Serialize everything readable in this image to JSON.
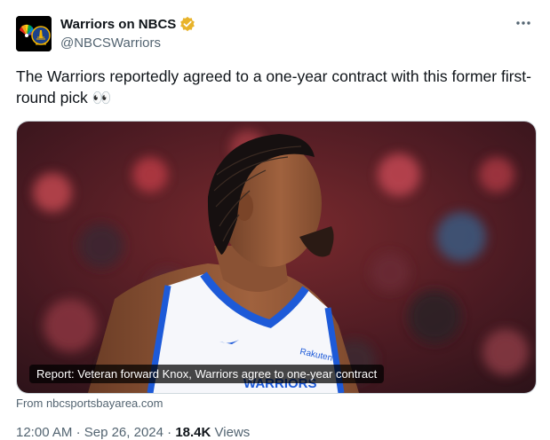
{
  "header": {
    "display_name": "Warriors on NBCS",
    "handle": "@NBCSWarriors",
    "verified_icon": "verified-badge-gold-icon",
    "more_icon": "more-options-icon"
  },
  "tweet": {
    "text": "The Warriors reportedly agreed to a one-year contract with this former first-round pick 👀"
  },
  "media": {
    "caption": "Report: Veteran forward Knox, Warriors agree to one-year contract",
    "jersey_text": "WARRIORS",
    "sponsor_text": "Rakuten"
  },
  "source": {
    "text": "From nbcsportsbayarea.com"
  },
  "meta": {
    "time": "12:00 AM",
    "separator": "·",
    "date": "Sep 26, 2024",
    "views_count": "18.4K",
    "views_label": "Views"
  },
  "colors": {
    "brand_gold": "#f4b400",
    "text_primary": "#0f1419",
    "text_secondary": "#536471",
    "jersey_blue": "#1d5ad8"
  }
}
